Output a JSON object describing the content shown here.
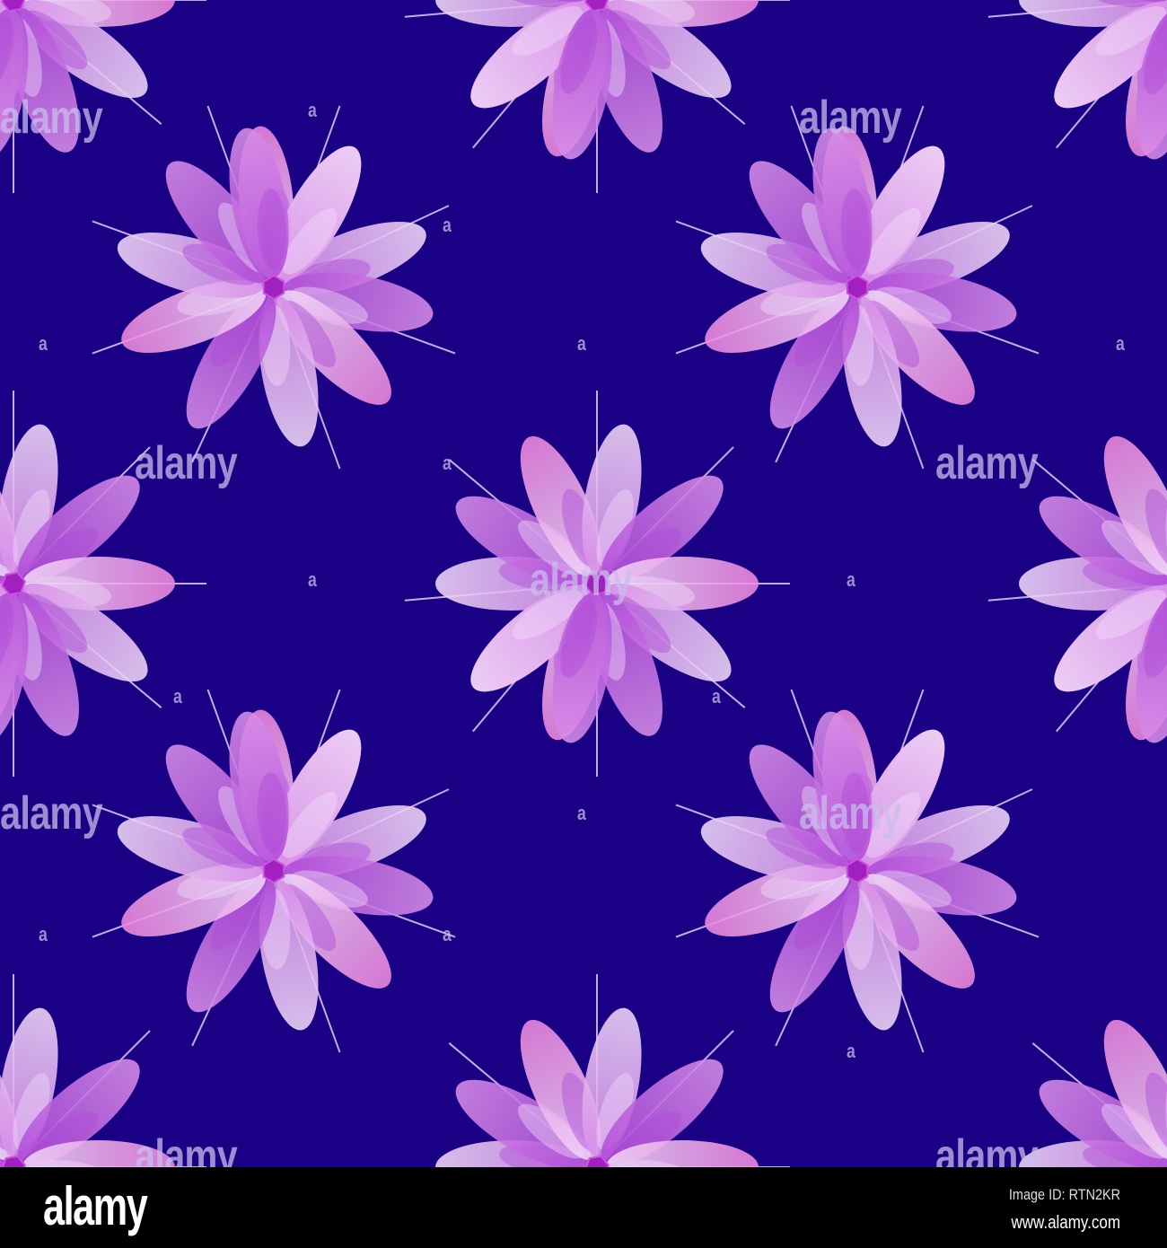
{
  "colors": {
    "background": "#1a0085",
    "petal_light": "#f0d8f8",
    "petal_mid": "#d88ee8",
    "petal_deep": "#b04cd8",
    "petal_pink": "#ee88dd",
    "center": "#a020c0"
  },
  "watermark": {
    "text": "alamy",
    "small_text": "a"
  },
  "footer": {
    "logo": "alamy",
    "image_id": "Image ID: RTN2KR",
    "url": "www.alamy.com"
  }
}
